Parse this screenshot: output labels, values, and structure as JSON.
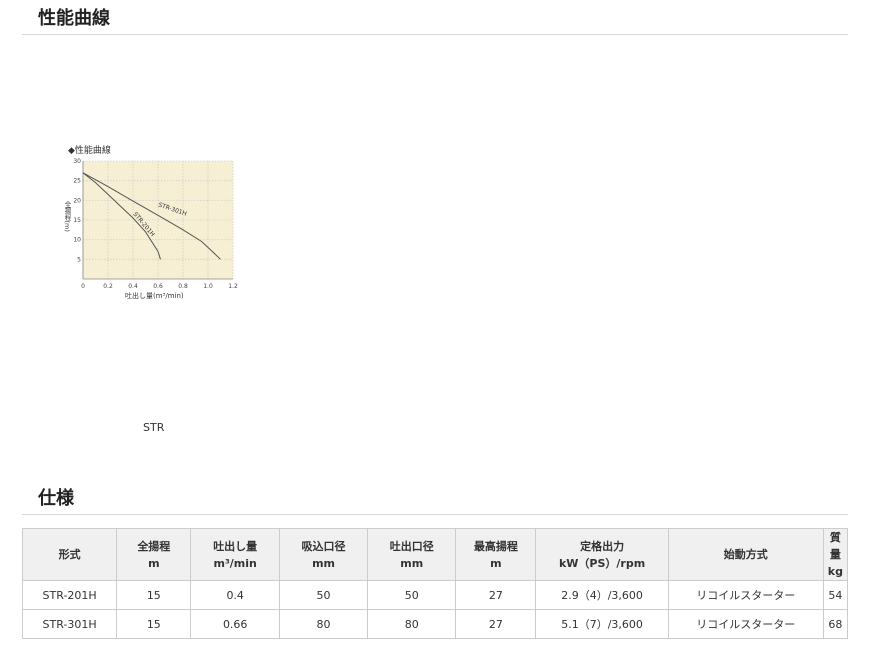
{
  "sections": {
    "performance_title": "性能曲線",
    "spec_title": "仕様"
  },
  "chart_caption": "STR",
  "chart_data": {
    "type": "line",
    "title": "◆性能曲線",
    "xlabel": "吐出し量(m³/min)",
    "ylabel": "全揚程(m)",
    "xlim": [
      0,
      1.2
    ],
    "ylim": [
      0,
      30
    ],
    "xticks": [
      "0",
      "0.2",
      "0.4",
      "0.6",
      "0.8",
      "1.0",
      "1.2"
    ],
    "yticks": [
      "5",
      "10",
      "15",
      "20",
      "25",
      "30"
    ],
    "background": "#f6efd3",
    "line_color": "#555555",
    "series": [
      {
        "name": "STR-301H",
        "x": [
          0,
          0.2,
          0.4,
          0.6,
          0.8,
          0.95,
          1.05,
          1.1
        ],
        "y": [
          27,
          23.5,
          19.8,
          16.2,
          12.5,
          9.5,
          6.5,
          5
        ]
      },
      {
        "name": "STR-201H",
        "x": [
          0,
          0.1,
          0.2,
          0.3,
          0.4,
          0.5,
          0.6,
          0.62
        ],
        "y": [
          27,
          24.5,
          21.5,
          18.5,
          15.5,
          12,
          7,
          5
        ]
      }
    ]
  },
  "table": {
    "headers": [
      [
        "形式"
      ],
      [
        "全揚程",
        "m"
      ],
      [
        "吐出し量",
        "m³/min"
      ],
      [
        "吸込口径",
        "mm"
      ],
      [
        "吐出口径",
        "mm"
      ],
      [
        "最高揚程",
        "m"
      ],
      [
        "定格出力",
        "kW（PS）/rpm"
      ],
      [
        "始動方式"
      ],
      [
        "質量",
        "kg"
      ]
    ],
    "rows": [
      [
        "STR-201H",
        "15",
        "0.4",
        "50",
        "50",
        "27",
        "2.9（4）/3,600",
        "リコイルスターター",
        "54"
      ],
      [
        "STR-301H",
        "15",
        "0.66",
        "80",
        "80",
        "27",
        "5.1（7）/3,600",
        "リコイルスターター",
        "68"
      ]
    ]
  }
}
